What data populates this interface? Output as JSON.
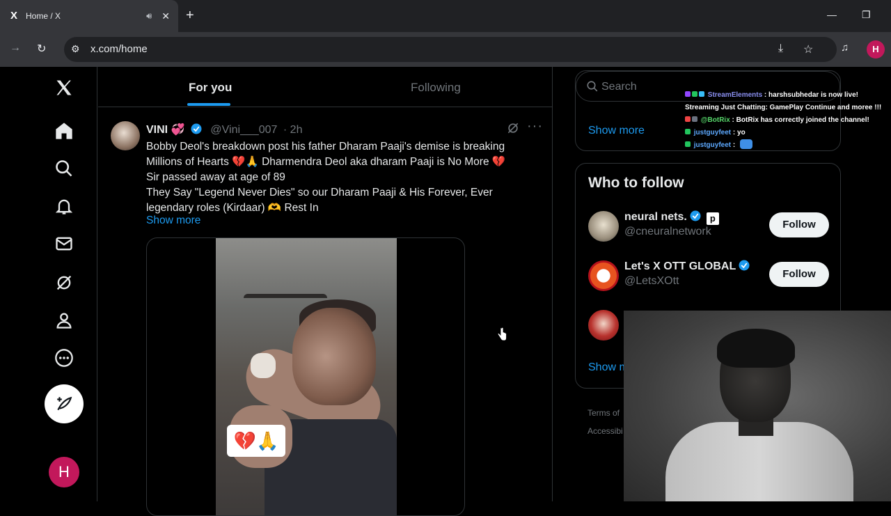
{
  "browser": {
    "tab_title": "Home / X",
    "favicon": "X",
    "url": "x.com/home",
    "profile_initial": "H"
  },
  "feed_tabs": {
    "for_you": "For you",
    "following": "Following"
  },
  "tweet": {
    "name": "VINI",
    "name_emoji": "💞",
    "handle": "@Vini___007",
    "time": "· 2h",
    "lines": [
      "Bobby Deol's breakdown post his father Dharam Paaji's demise is breaking",
      "Millions of Hearts 💔🙏 Dharmendra Deol aka dharam Paaji is No More 💔",
      "Sir passed away at age of 89",
      "They Say \"Legend Never Dies\" so our Dharam Paaji & His Forever, Ever",
      "legendary roles (Kirdaar) 🫶 Rest In"
    ],
    "show_more": "Show more",
    "sticker": "💔🙏"
  },
  "sidebar": {
    "search_placeholder": "Search",
    "trends_show_more": "Show more",
    "who_to_follow_title": "Who to follow",
    "suggestions": [
      {
        "name": "neural nets.",
        "badge": "p",
        "handle": "@cneuralnetwork",
        "button": "Follow"
      },
      {
        "name": "Let's X OTT GLOBAL",
        "handle": "@LetsXOtt",
        "button": "Follow"
      }
    ],
    "wtf_show_more": "Show m",
    "footer": [
      "Terms of",
      "Accessibi"
    ]
  },
  "stream_chat": [
    {
      "user": "StreamElements",
      "sep": " : ",
      "text": "harshsubhedar is now live! Streaming Just Chatting: GamePlay Continue and moree !!!"
    },
    {
      "user": "@BotRix",
      "sep": " : ",
      "text": "BotRix has correctly joined the channel!"
    },
    {
      "user": "justguyfeet",
      "sep": " : ",
      "text": "yo"
    },
    {
      "user": "justguyfeet",
      "sep": " : ",
      "text": ""
    }
  ],
  "nav_profile_initial": "H",
  "colors": {
    "accent": "#1d9bf0",
    "background": "#000000",
    "profile": "#c2185b"
  }
}
